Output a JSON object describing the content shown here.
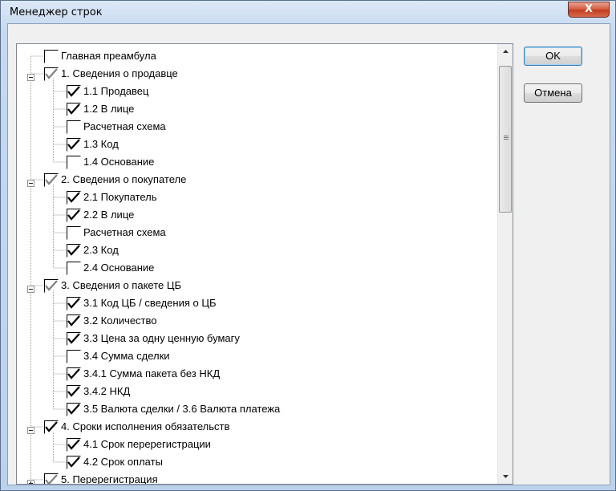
{
  "window": {
    "title": "Менеджер строк",
    "close_glyph": "X"
  },
  "buttons": {
    "ok": "OK",
    "cancel": "Отмена"
  },
  "colors": {
    "check": "#000000",
    "check_gray": "#808080",
    "tree_line": "#a0a0a0"
  },
  "tree": {
    "items": [
      {
        "label": "Главная преамбула",
        "level": 0,
        "expander": "none",
        "state": "unchecked"
      },
      {
        "label": "1. Сведения о продавце",
        "level": 0,
        "expander": "minus",
        "state": "checked-gray"
      },
      {
        "label": "1.1 Продавец",
        "level": 1,
        "expander": "none",
        "state": "checked"
      },
      {
        "label": "1.2 В лице",
        "level": 1,
        "expander": "none",
        "state": "checked"
      },
      {
        "label": "Расчетная схема",
        "level": 1,
        "expander": "none",
        "state": "unchecked"
      },
      {
        "label": "1.3 Код",
        "level": 1,
        "expander": "none",
        "state": "checked"
      },
      {
        "label": "1.4 Основание",
        "level": 1,
        "expander": "none",
        "state": "unchecked"
      },
      {
        "label": "2. Сведения о покупателе",
        "level": 0,
        "expander": "minus",
        "state": "checked-gray"
      },
      {
        "label": "2.1 Покупатель",
        "level": 1,
        "expander": "none",
        "state": "checked"
      },
      {
        "label": "2.2 В лице",
        "level": 1,
        "expander": "none",
        "state": "checked"
      },
      {
        "label": "Расчетная схема",
        "level": 1,
        "expander": "none",
        "state": "unchecked"
      },
      {
        "label": "2.3 Код",
        "level": 1,
        "expander": "none",
        "state": "checked"
      },
      {
        "label": "2.4 Основание",
        "level": 1,
        "expander": "none",
        "state": "unchecked"
      },
      {
        "label": "3. Сведения о пакете ЦБ",
        "level": 0,
        "expander": "minus",
        "state": "checked-gray"
      },
      {
        "label": "3.1 Код ЦБ / сведения о ЦБ",
        "level": 1,
        "expander": "none",
        "state": "checked"
      },
      {
        "label": "3.2 Количество",
        "level": 1,
        "expander": "none",
        "state": "checked"
      },
      {
        "label": "3.3 Цена за одну ценную бумагу",
        "level": 1,
        "expander": "none",
        "state": "checked"
      },
      {
        "label": "3.4 Сумма сделки",
        "level": 1,
        "expander": "none",
        "state": "unchecked"
      },
      {
        "label": "3.4.1 Сумма пакета без НКД",
        "level": 1,
        "expander": "none",
        "state": "checked"
      },
      {
        "label": "3.4.2 НКД",
        "level": 1,
        "expander": "none",
        "state": "checked"
      },
      {
        "label": "3.5 Валюта сделки / 3.6 Валюта платежа",
        "level": 1,
        "expander": "none",
        "state": "checked"
      },
      {
        "label": "4. Сроки исполнения обязательств",
        "level": 0,
        "expander": "minus",
        "state": "checked"
      },
      {
        "label": "4.1 Срок перерегистрации",
        "level": 1,
        "expander": "none",
        "state": "checked"
      },
      {
        "label": "4.2 Срок оплаты",
        "level": 1,
        "expander": "none",
        "state": "checked"
      },
      {
        "label": "5. Перерегистрация",
        "level": 0,
        "expander": "plus",
        "state": "checked-gray"
      }
    ]
  }
}
